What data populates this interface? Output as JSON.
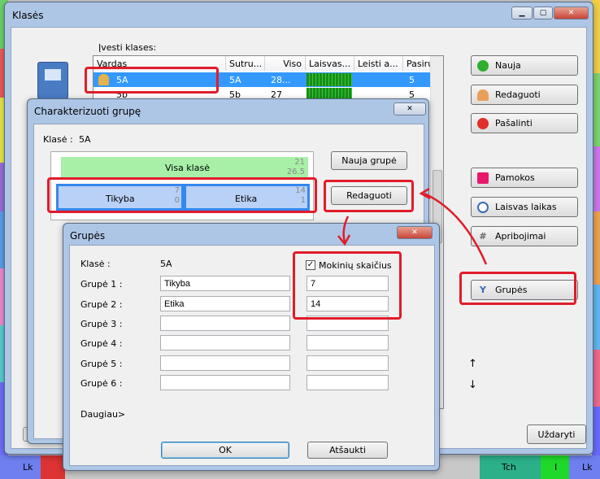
{
  "main_window": {
    "title": "Klasės",
    "enter_label": "Įvesti klases:",
    "columns": [
      "Vardas",
      "Sutru...",
      "Viso",
      "Laisvas...",
      "Leisti a...",
      "Pasiruo..."
    ],
    "rows": [
      {
        "name": "5A",
        "short": "5A",
        "total": "28...",
        "prep": "5"
      },
      {
        "name": "5b",
        "short": "5b",
        "total": "27",
        "prep": "5"
      }
    ],
    "side_buttons": {
      "new": "Nauja",
      "edit": "Redaguoti",
      "delete": "Pašalinti",
      "lessons": "Pamokos",
      "free_time": "Laisvas laikas",
      "limits": "Apribojimai",
      "groups": "Grupės"
    },
    "close": "Uždaryti"
  },
  "char_dialog": {
    "title": "Charakterizuoti grupę",
    "class_label": "Klasė :",
    "class_value": "5A",
    "whole_class": "Visa klasė",
    "whole_n1": "21",
    "whole_n2": "26.5",
    "group1": "Tikyba",
    "group1_n1": "7",
    "group1_n2": "0",
    "group2": "Etika",
    "group2_n1": "14",
    "group2_n2": "1",
    "new_group": "Nauja grupė",
    "edit": "Redaguoti"
  },
  "groups_dialog": {
    "title": "Grupės",
    "class_label": "Klasė :",
    "class_value": "5A",
    "count_label": "Mokinių skaičius",
    "count_checked": true,
    "rows": [
      {
        "label": "Grupė 1 :",
        "name": "Tikyba",
        "count": "7"
      },
      {
        "label": "Grupė 2 :",
        "name": "Etika",
        "count": "14"
      },
      {
        "label": "Grupė 3 :",
        "name": "",
        "count": ""
      },
      {
        "label": "Grupė 4 :",
        "name": "",
        "count": ""
      },
      {
        "label": "Grupė 5 :",
        "name": "",
        "count": ""
      },
      {
        "label": "Grupė 6 :",
        "name": "",
        "count": ""
      }
    ],
    "more": "Daugiau>",
    "ok": "OK",
    "cancel": "Atšaukti",
    "close_glyph": "✕"
  },
  "bottom_strip": {
    "left": "Lk",
    "tch": "Tch",
    "i": "I",
    "right": "Lk"
  },
  "arrows": {
    "up": "↑",
    "down": "↓"
  },
  "colors": {
    "accent": "#3399ff",
    "annotation": "#e01c2a",
    "whole_class_bg": "#a8f0a8",
    "group_bg": "#b9d0f7"
  }
}
